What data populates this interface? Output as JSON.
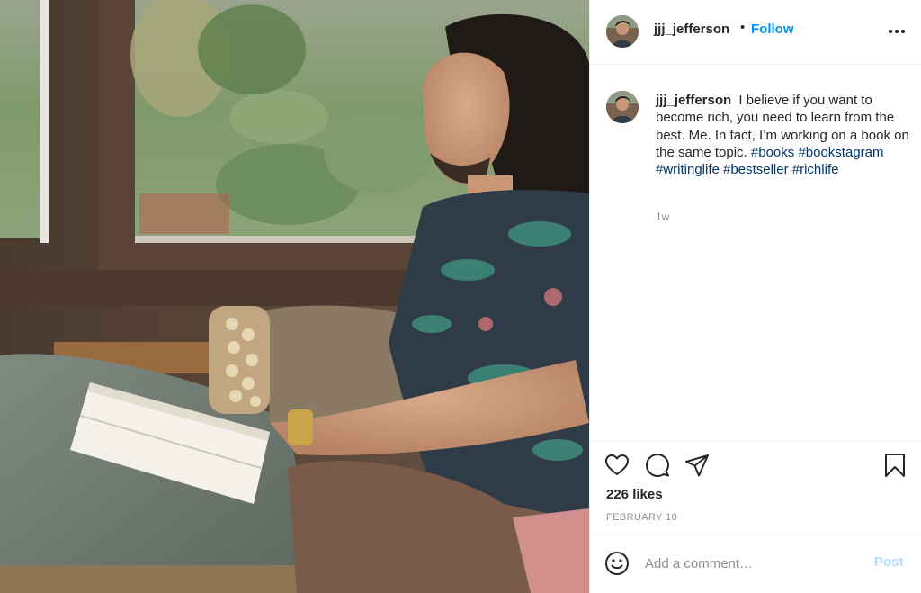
{
  "post": {
    "image_alt": "Man in a floral shirt sitting by a window next to an open book",
    "author": {
      "username": "jjj_jefferson",
      "dot": "•",
      "follow_label": "Follow",
      "avatar_icon": "user-avatar"
    },
    "caption": {
      "username": "jjj_jefferson",
      "text": "I believe if you want to become rich, you need to learn from the best. Me. In fact, I’m working on a book on the same topic.",
      "hashtags": [
        "#books",
        "#bookstagram",
        "#writinglife",
        "#bestseller",
        "#richlife"
      ],
      "time_ago": "1w"
    },
    "actions": {
      "icons": [
        "heart-icon",
        "comment-icon",
        "share-icon",
        "bookmark-icon"
      ]
    },
    "likes": "226 likes",
    "date": "FEBRUARY 10",
    "comment_box": {
      "placeholder": "Add a comment…",
      "post_label": "Post",
      "emoji_icon": "smiley-icon"
    },
    "colors": {
      "follow": "#0095f6",
      "hashtag": "#00376b",
      "post_disabled": "#b3dbff",
      "muted": "#8e8e8e"
    }
  }
}
